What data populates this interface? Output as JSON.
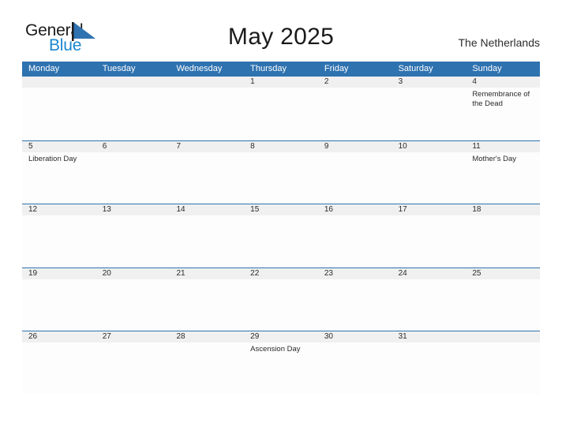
{
  "brand": {
    "name_part1": "General",
    "name_part2": "Blue",
    "flag_color": "#2e72b0",
    "text_color_1": "#1b1b1b",
    "text_color_2": "#1b86d0"
  },
  "header": {
    "title": "May 2025",
    "region": "The Netherlands"
  },
  "theme": {
    "header_blue": "#2e72b0",
    "band_gray": "#f0f0f0",
    "cell_white": "#fdfdfd",
    "text_dark": "#2a2a2a"
  },
  "weekdays": [
    "Monday",
    "Tuesday",
    "Wednesday",
    "Thursday",
    "Friday",
    "Saturday",
    "Sunday"
  ],
  "weeks": [
    [
      {
        "day": "",
        "events": []
      },
      {
        "day": "",
        "events": []
      },
      {
        "day": "",
        "events": []
      },
      {
        "day": "1",
        "events": []
      },
      {
        "day": "2",
        "events": []
      },
      {
        "day": "3",
        "events": []
      },
      {
        "day": "4",
        "events": [
          "Remembrance of the Dead"
        ]
      }
    ],
    [
      {
        "day": "5",
        "events": [
          "Liberation Day"
        ]
      },
      {
        "day": "6",
        "events": []
      },
      {
        "day": "7",
        "events": []
      },
      {
        "day": "8",
        "events": []
      },
      {
        "day": "9",
        "events": []
      },
      {
        "day": "10",
        "events": []
      },
      {
        "day": "11",
        "events": [
          "Mother's Day"
        ]
      }
    ],
    [
      {
        "day": "12",
        "events": []
      },
      {
        "day": "13",
        "events": []
      },
      {
        "day": "14",
        "events": []
      },
      {
        "day": "15",
        "events": []
      },
      {
        "day": "16",
        "events": []
      },
      {
        "day": "17",
        "events": []
      },
      {
        "day": "18",
        "events": []
      }
    ],
    [
      {
        "day": "19",
        "events": []
      },
      {
        "day": "20",
        "events": []
      },
      {
        "day": "21",
        "events": []
      },
      {
        "day": "22",
        "events": []
      },
      {
        "day": "23",
        "events": []
      },
      {
        "day": "24",
        "events": []
      },
      {
        "day": "25",
        "events": []
      }
    ],
    [
      {
        "day": "26",
        "events": []
      },
      {
        "day": "27",
        "events": []
      },
      {
        "day": "28",
        "events": []
      },
      {
        "day": "29",
        "events": [
          "Ascension Day"
        ]
      },
      {
        "day": "30",
        "events": []
      },
      {
        "day": "31",
        "events": []
      },
      {
        "day": "",
        "events": []
      }
    ]
  ]
}
